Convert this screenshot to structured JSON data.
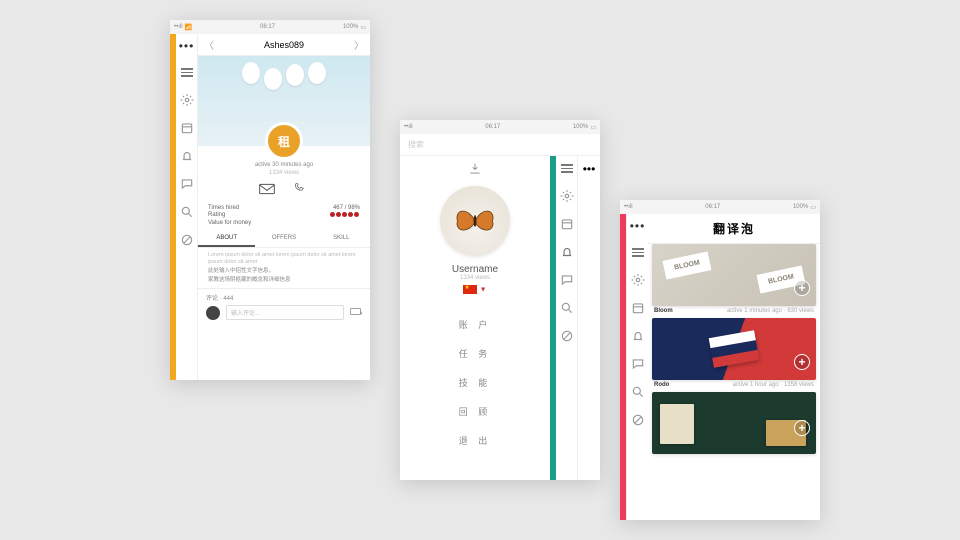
{
  "statusbar": {
    "time": "06:17",
    "battery": "100%"
  },
  "rail": {
    "icons": [
      "gear-icon",
      "calendar-icon",
      "bell-icon",
      "chat-icon",
      "search-icon",
      "block-icon"
    ]
  },
  "phone1": {
    "accent": "#f2a81d",
    "header": {
      "title": "Ashes089"
    },
    "avatar_badge": "租",
    "meta": {
      "active": "active 30 minutes ago",
      "views": "1334 views"
    },
    "stats": {
      "times_hired_label": "Times hired",
      "times_hired_value": "467 / 98%",
      "rating_label": "Rating",
      "rating_value_dots": 5,
      "vfm_label": "Value for money"
    },
    "tabs": {
      "about": "ABOUT",
      "offers": "OFFERS",
      "skill": "SKILL"
    },
    "about": {
      "latin": "Lorem ipsum dolor sit amet lorem ipsum dolor sit amet lorem ipsum dolor sit amet",
      "cn1": "此处输入中招性文字信息，",
      "cn2": "家教这场阴柩藏的概念和详细信息"
    },
    "comments": {
      "header": "评论 · 444",
      "placeholder": "输入评论…"
    }
  },
  "phone2": {
    "accent": "#1a9e8a",
    "search_placeholder": "搜索",
    "username_label": "Username",
    "views": "1334 views",
    "menu": [
      "账 户",
      "任 务",
      "技 能",
      "回 顾",
      "退 出"
    ]
  },
  "phone3": {
    "accent": "#ef3b5b",
    "brand": "翻译泡",
    "cards": [
      {
        "title": "Bloom",
        "meta": "active 1 minutes ago · 630 views"
      },
      {
        "title": "Rodo",
        "meta": "active 1 hour ago · 1358 views"
      },
      {
        "title": "",
        "meta": ""
      }
    ]
  }
}
